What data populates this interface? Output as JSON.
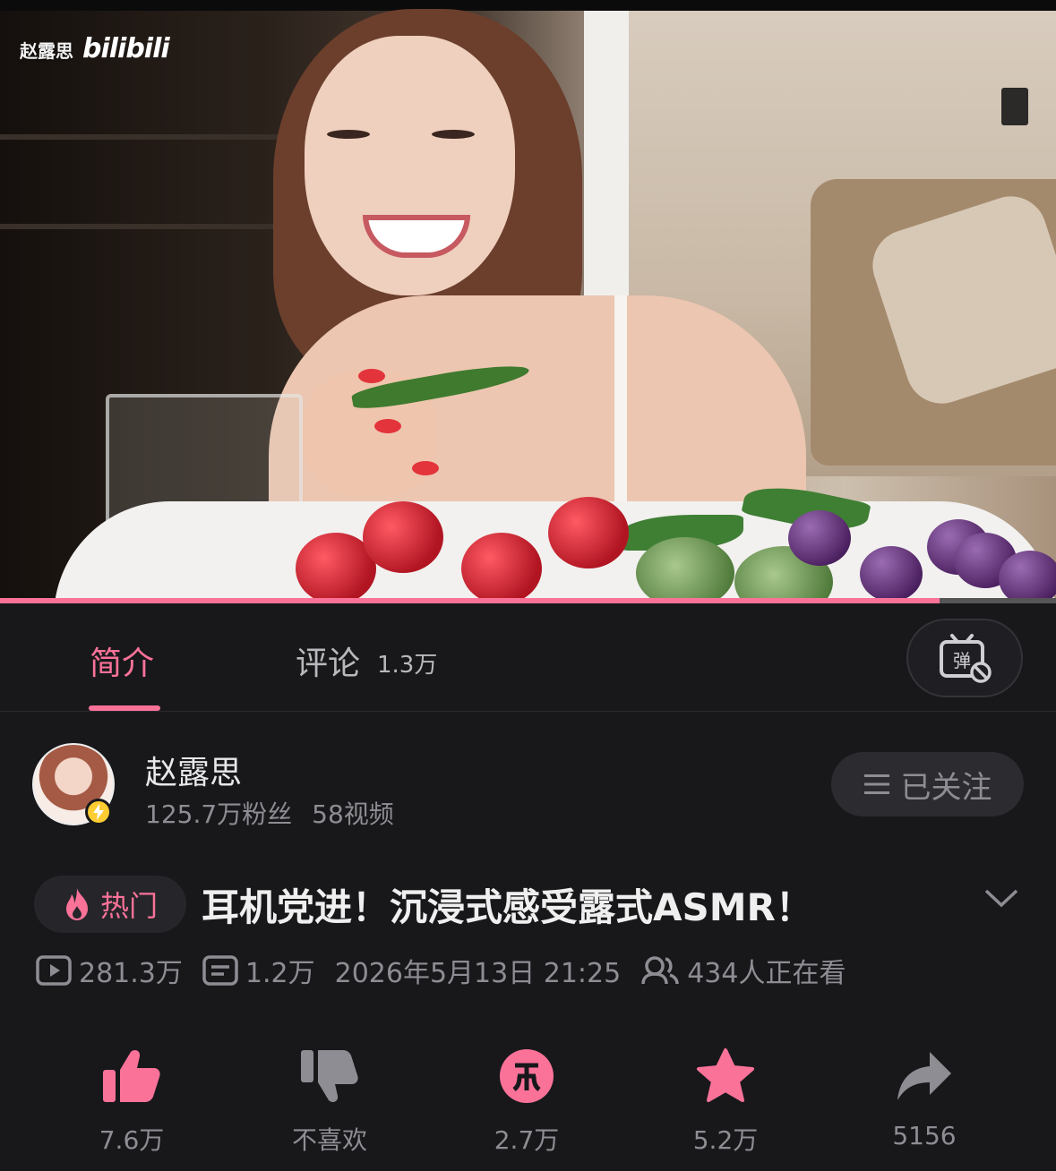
{
  "video": {
    "watermark_name": "赵露思",
    "watermark_logo": "bilibili",
    "progress": 0.89
  },
  "tabs": {
    "intro_label": "简介",
    "comments_label": "评论",
    "comments_count": "1.3万",
    "danmaku_icon": "danmaku-off-icon"
  },
  "uploader": {
    "name": "赵露思",
    "fans": "125.7万粉丝",
    "videos": "58视频",
    "follow_label": "已关注"
  },
  "title": {
    "hot_label": "热门",
    "text": "耳机党进！沉浸式感受露式ASMR！"
  },
  "meta": {
    "views": "281.3万",
    "danmaku": "1.2万",
    "date": "2026年5月13日 21:25",
    "watching": "434人正在看"
  },
  "actions": {
    "like": "7.6万",
    "dislike": "不喜欢",
    "coin": "2.7万",
    "favorite": "5.2万",
    "share": "5156"
  },
  "colors": {
    "accent": "#fb7299",
    "background": "#18181b",
    "secondary_text": "#8d8d93"
  }
}
